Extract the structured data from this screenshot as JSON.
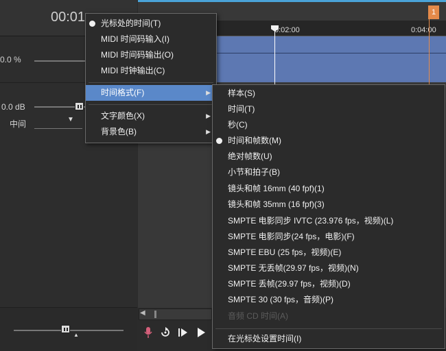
{
  "track_header": {
    "time_display": "00:01",
    "volume": "0.0 %",
    "pan_db": "0.0 dB",
    "pan_mode": "中间"
  },
  "ruler": {
    "tick_1": "0:02:00",
    "tick_2": "0:04:00",
    "marker_label": "1"
  },
  "context_menu": {
    "items": [
      {
        "label": "光标处的时间(T)",
        "checked": true
      },
      {
        "label": "MIDI 时间码输入(I)"
      },
      {
        "label": "MIDI 时间码输出(O)"
      },
      {
        "label": "MIDI 时钟输出(C)"
      },
      {
        "label": "时间格式(F)",
        "submenu": true,
        "highlighted": true
      },
      {
        "label": "文字颜色(X)",
        "submenu": true
      },
      {
        "label": "背景色(B)",
        "submenu": true
      }
    ]
  },
  "time_format_submenu": {
    "items": [
      {
        "label": "样本(S)"
      },
      {
        "label": "时间(T)"
      },
      {
        "label": "秒(C)"
      },
      {
        "label": "时间和帧数(M)",
        "checked": true
      },
      {
        "label": "绝对帧数(U)"
      },
      {
        "label": "小节和拍子(B)"
      },
      {
        "label": "镜头和帧 16mm (40 fpf)(1)"
      },
      {
        "label": "镜头和帧 35mm (16 fpf)(3)"
      },
      {
        "label": "SMPTE 电影同步 IVTC (23.976 fps，视频)(L)"
      },
      {
        "label": "SMPTE 电影同步(24 fps，电影)(F)"
      },
      {
        "label": "SMPTE EBU (25 fps，视频)(E)"
      },
      {
        "label": "SMPTE 无丢帧(29.97 fps，视频)(N)"
      },
      {
        "label": "SMPTE 丢帧(29.97 fps，视频)(D)"
      },
      {
        "label": "SMPTE 30 (30 fps，音频)(P)"
      },
      {
        "label": "音频 CD 时间(A)",
        "disabled": true
      },
      {
        "label": "在光标处设置时间(I)"
      }
    ]
  },
  "transport": {
    "icons": [
      "record-icon",
      "loop-icon",
      "play-from-start-icon",
      "play-icon"
    ]
  },
  "colors": {
    "highlight": "#5a88c9",
    "clip": "#5d78b2",
    "marker": "#e58a4a"
  }
}
